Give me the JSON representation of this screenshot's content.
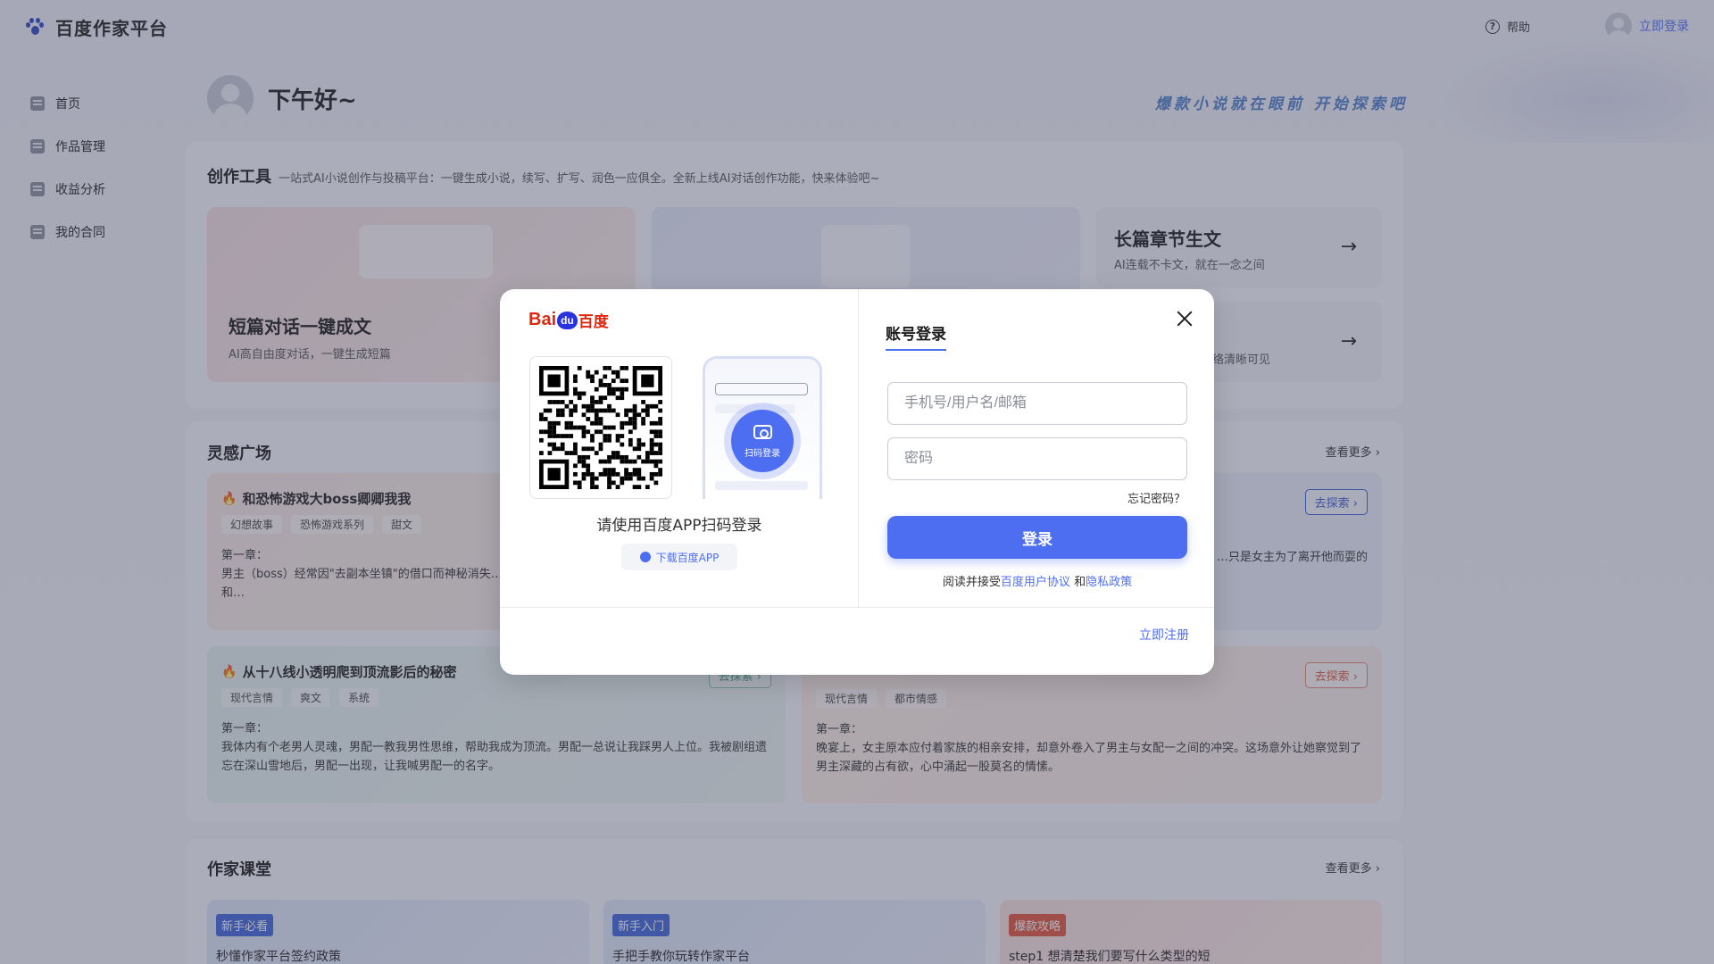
{
  "header": {
    "site_title": "百度作家平台",
    "help": "帮助",
    "login": "立即登录"
  },
  "sidebar": {
    "items": [
      {
        "label": "首页",
        "icon": "home-icon"
      },
      {
        "label": "作品管理",
        "icon": "works-icon"
      },
      {
        "label": "收益分析",
        "icon": "income-icon"
      },
      {
        "label": "我的合同",
        "icon": "contract-icon"
      }
    ]
  },
  "greeting": {
    "text": "下午好~",
    "slogan": "爆款小说就在眼前  开始探索吧"
  },
  "tools": {
    "title": "创作工具",
    "desc": "一站式AI小说创作与投稿平台：一键生成小说，续写、扩写、润色一应俱全。全新上线AI对话创作功能，快来体验吧~",
    "cards": [
      {
        "title": "短篇对话一键成文",
        "sub": "AI高自由度对话，一键生成短篇"
      },
      {
        "title": "",
        "sub": ""
      },
      {
        "title": "长篇章节生文",
        "sub": "AI连载不卡文，就在一念之间"
      },
      {
        "title": "",
        "sub": "络清晰可见"
      }
    ]
  },
  "inspiration": {
    "title": "灵感广场",
    "more": "查看更多",
    "explore": "去探索",
    "stories": [
      {
        "title": "和恐怖游戏大boss卿卿我我",
        "tags": [
          "幻想故事",
          "恐怖游戏系列",
          "甜文"
        ],
        "chapter_label": "第一章：",
        "text": "男主（boss）经常因\"去副本坐镇\"的借口而神秘消失…下，男主（boss）巧妙地转移了话题，用他的机智和…"
      },
      {
        "title": "",
        "tags": [],
        "chapter_label": "",
        "text": "…只是女主为了离开他而耍的"
      },
      {
        "title": "从十八线小透明爬到顶流影后的秘密",
        "tags": [
          "现代言情",
          "爽文",
          "系统"
        ],
        "chapter_label": "第一章：",
        "text": "我体内有个老男人灵魂，男配一教我男性思维，帮助我成为顶流。男配一总说让我踩男人上位。我被剧组遗忘在深山雪地后，男配一出现，让我喊男配一的名字。"
      },
      {
        "title": "",
        "tags": [
          "现代言情",
          "都市情感"
        ],
        "chapter_label": "第一章：",
        "text": "晚宴上，女主原本应付着家族的相亲安排，却意外卷入了男主与女配一之间的冲突。这场意外让她察觉到了男主深藏的占有欲，心中涌起一股莫名的情愫。"
      }
    ]
  },
  "classroom": {
    "title": "作家课堂",
    "more": "查看更多",
    "cards": [
      {
        "badge": "新手必看",
        "title": "秒懂作家平台签约政策"
      },
      {
        "badge": "新手入门",
        "title": "手把手教你玩转作家平台"
      },
      {
        "badge": "爆款攻略",
        "title": "step1 想清楚我们要写什么类型的短"
      }
    ]
  },
  "modal": {
    "logo_bai": "Bai",
    "logo_du": "du",
    "logo_cn": "百度",
    "scan_label": "扫码登录",
    "qr_hint": "请使用百度APP扫码登录",
    "download_app": "下载百度APP",
    "tab_title": "账号登录",
    "username_placeholder": "手机号/用户名/邮箱",
    "password_placeholder": "密码",
    "forgot": "忘记密码？",
    "login_button": "登录",
    "agree_prefix": "阅读并接受",
    "user_agreement": "百度用户协议",
    "agree_and": "和",
    "privacy": "隐私政策",
    "register": "立即注册"
  },
  "colors": {
    "accent": "#4e6ef2",
    "baidu_red": "#de2910",
    "baidu_blue": "#2932e1"
  }
}
